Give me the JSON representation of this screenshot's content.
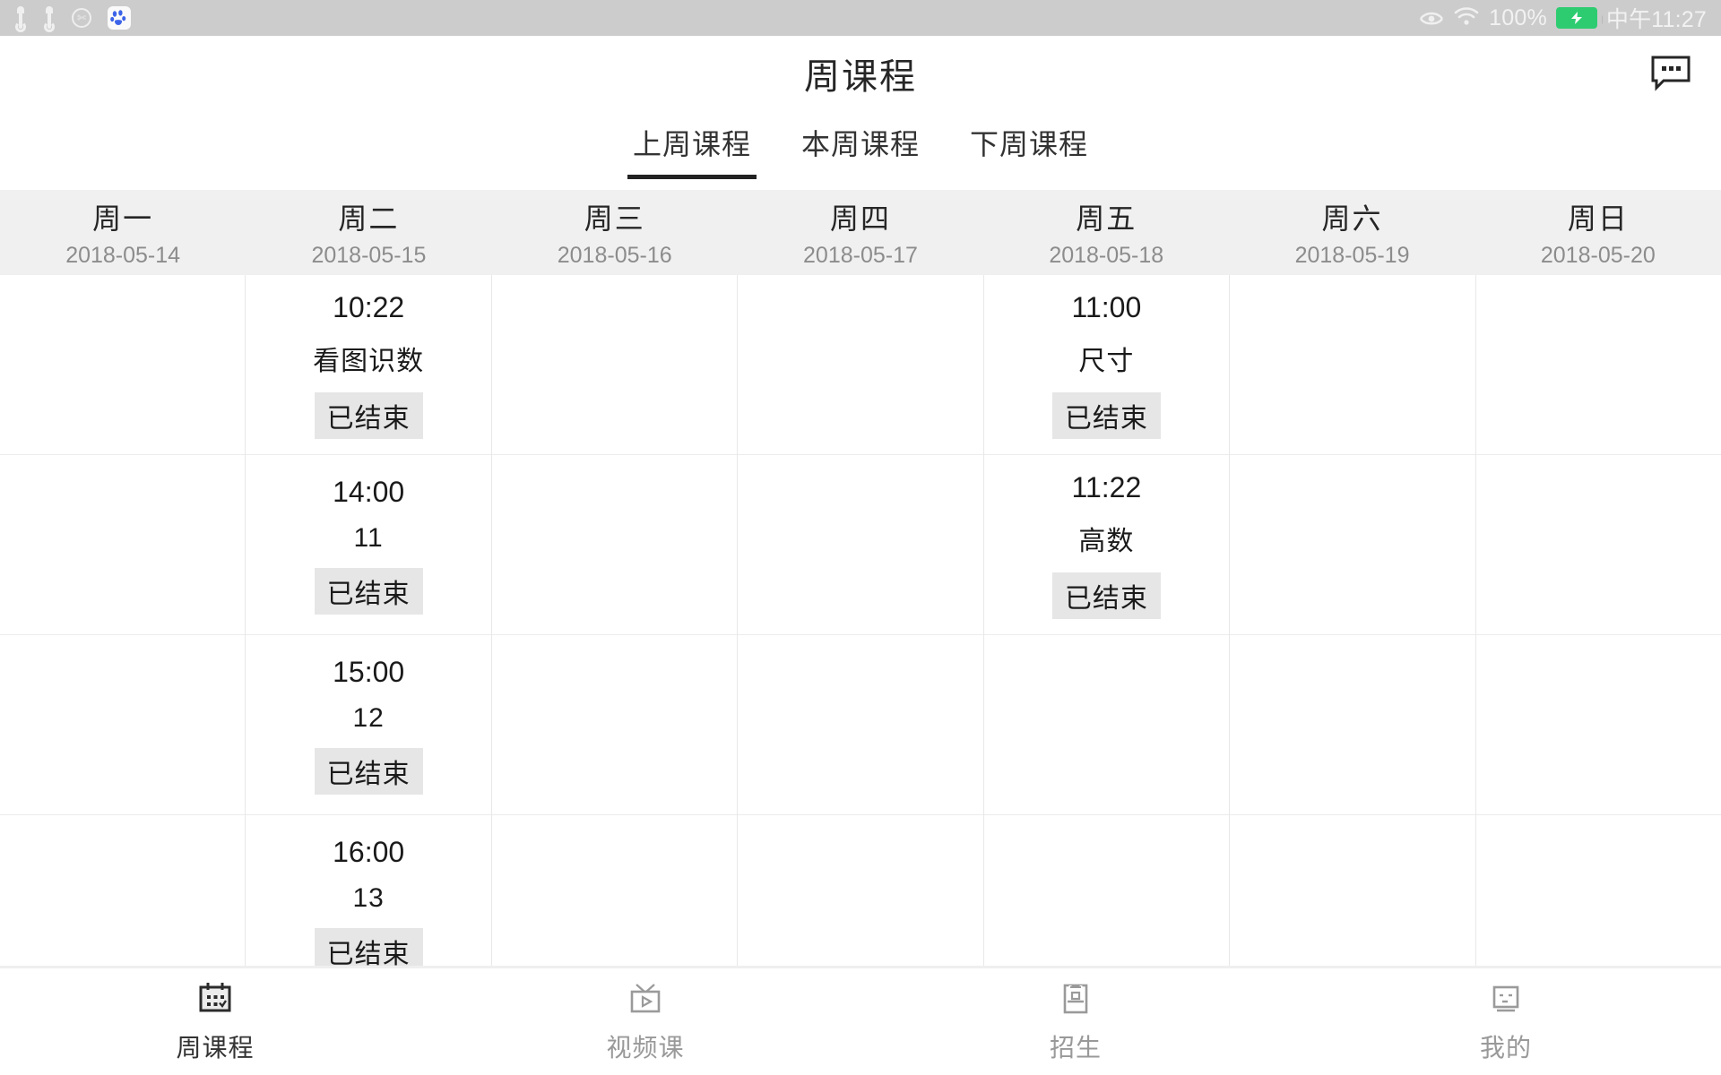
{
  "statusbar": {
    "left_icons": [
      "usb-icon",
      "usb-icon",
      "scissors-circle-icon",
      "baidu-paw-icon"
    ],
    "eye_icon": "eye-care-icon",
    "wifi_icon": "wifi-icon",
    "battery_percent": "100%",
    "battery_icon": "battery-charging-icon",
    "time": "中午11:27",
    "bg_color": "#cccccc",
    "battery_color": "#2ecc71"
  },
  "header": {
    "title": "周课程",
    "action_icon": "chat-bubble-icon"
  },
  "tabs": {
    "items": [
      {
        "label": "上周课程",
        "active": true
      },
      {
        "label": "本周课程",
        "active": false
      },
      {
        "label": "下周课程",
        "active": false
      }
    ],
    "active_indicator_color": "#222222"
  },
  "week_header": {
    "bg_color": "#f0f0f0",
    "days": [
      {
        "day": "周一",
        "date": "2018-05-14"
      },
      {
        "day": "周二",
        "date": "2018-05-15"
      },
      {
        "day": "周三",
        "date": "2018-05-16"
      },
      {
        "day": "周四",
        "date": "2018-05-17"
      },
      {
        "day": "周五",
        "date": "2018-05-18"
      },
      {
        "day": "周六",
        "date": "2018-05-19"
      },
      {
        "day": "周日",
        "date": "2018-05-20"
      }
    ]
  },
  "schedule": {
    "badge_bg_color": "#e6e6e6",
    "columns": [
      {
        "day": "周一",
        "cells": [
          {},
          {},
          {},
          {}
        ]
      },
      {
        "day": "周二",
        "cells": [
          {
            "time": "10:22",
            "name": "看图识数",
            "status": "已结束"
          },
          {
            "time": "14:00",
            "name": "11",
            "status": "已结束"
          },
          {
            "time": "15:00",
            "name": "12",
            "status": "已结束"
          },
          {
            "time": "16:00",
            "name": "13",
            "status": "已结束"
          }
        ]
      },
      {
        "day": "周三",
        "cells": [
          {},
          {},
          {},
          {}
        ]
      },
      {
        "day": "周四",
        "cells": [
          {},
          {},
          {},
          {}
        ]
      },
      {
        "day": "周五",
        "cells": [
          {
            "time": "11:00",
            "name": "尺寸",
            "status": "已结束"
          },
          {
            "time": "11:22",
            "name": "高数",
            "status": "已结束"
          },
          {},
          {}
        ]
      },
      {
        "day": "周六",
        "cells": [
          {},
          {},
          {},
          {}
        ]
      },
      {
        "day": "周日",
        "cells": [
          {},
          {},
          {},
          {}
        ]
      }
    ]
  },
  "tabbar": {
    "items": [
      {
        "label": "周课程",
        "icon": "calendar-check-icon",
        "active": true
      },
      {
        "label": "视频课",
        "icon": "tv-play-icon",
        "active": false
      },
      {
        "label": "招生",
        "icon": "notice-board-icon",
        "active": false
      },
      {
        "label": "我的",
        "icon": "profile-face-icon",
        "active": false
      }
    ],
    "active_color": "#333333",
    "inactive_color": "#999999"
  }
}
